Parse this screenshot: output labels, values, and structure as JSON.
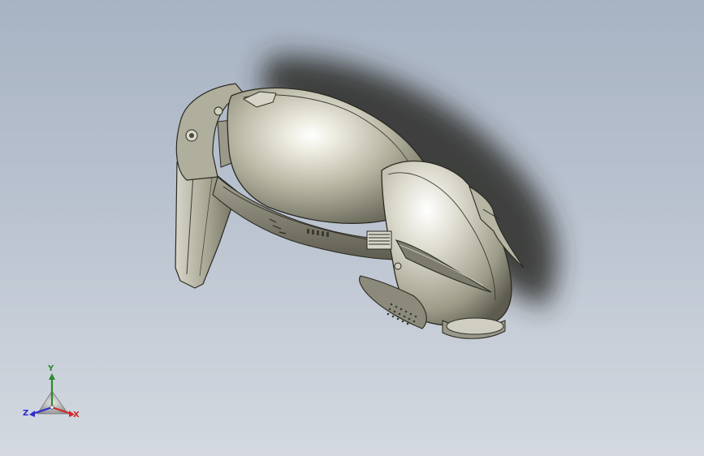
{
  "viewport": {
    "background_top": "#a7b3c3",
    "background_bottom": "#d4d9e0"
  },
  "model": {
    "material_color": "#c8c7b5",
    "edge_color": "#2a2a22"
  },
  "triad": {
    "y_label": "Y",
    "z_label": "Z",
    "x_label": "X",
    "y_color": "#2d8a2d",
    "z_color": "#2b2bd1",
    "x_color": "#d12b2b"
  }
}
